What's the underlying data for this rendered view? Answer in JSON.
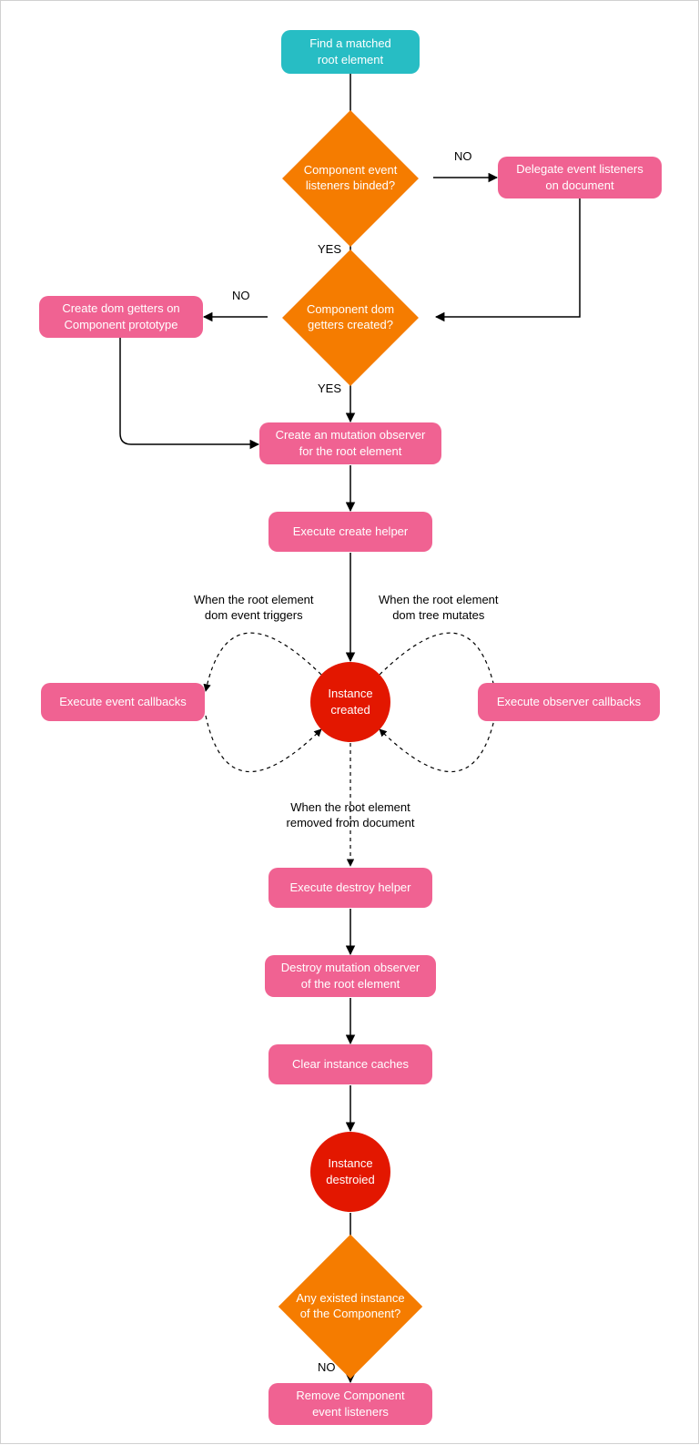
{
  "nodes": {
    "start": "Find a matched\nroot element",
    "d1": "Component event\nlisteners binded?",
    "delegate": "Delegate event listeners\non document",
    "d2": "Component dom\ngetters created?",
    "createGetters": "Create dom getters on\nComponent prototype",
    "mutationObs": "Create an mutation observer\nfor the root element",
    "execCreate": "Execute create helper",
    "instanceCreated": "Instance\ncreated",
    "execEvent": "Execute event callbacks",
    "execObserver": "Execute observer callbacks",
    "execDestroy": "Execute destroy helper",
    "destroyObs": "Destroy mutation observer\nof the root element",
    "clearCache": "Clear instance caches",
    "instanceDestroyed": "Instance\ndestroied",
    "d3": "Any existed instance\nof the Component?",
    "removeListeners": "Remove Component\nevent listeners"
  },
  "labels": {
    "no1": "NO",
    "yes1": "YES",
    "no2": "NO",
    "yes2": "YES",
    "loopLeft": "When the root element\ndom event triggers",
    "loopRight": "When the root element\ndom tree mutates",
    "removed": "When the root element\nremoved from document",
    "no3": "NO"
  },
  "colors": {
    "teal": "#27bdc4",
    "pink": "#f06292",
    "orange": "#f57c00",
    "red": "#e31700"
  }
}
